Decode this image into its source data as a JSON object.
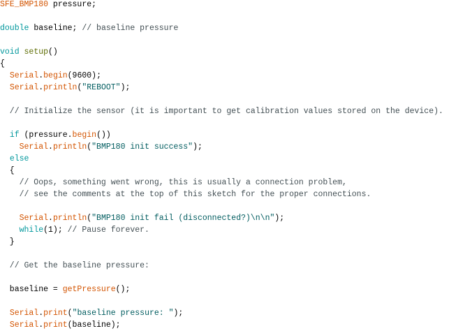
{
  "editor": {
    "colors": {
      "keyword": "#00979c",
      "function": "#d35400",
      "structure": "#5e6d03",
      "comment": "#434f54",
      "string": "#005c5f",
      "text": "#000000"
    },
    "lines": [
      [
        {
          "t": "SFE_BMP180",
          "c": "fn"
        },
        {
          "t": " pressure;",
          "c": "tx"
        }
      ],
      [],
      [
        {
          "t": "double",
          "c": "kw"
        },
        {
          "t": " baseline; ",
          "c": "tx"
        },
        {
          "t": "// baseline pressure",
          "c": "cm"
        }
      ],
      [],
      [
        {
          "t": "void",
          "c": "kw"
        },
        {
          "t": " ",
          "c": "tx"
        },
        {
          "t": "setup",
          "c": "setup"
        },
        {
          "t": "()",
          "c": "tx"
        }
      ],
      [
        {
          "t": "{",
          "c": "tx"
        }
      ],
      [
        {
          "t": "  ",
          "c": "tx"
        },
        {
          "t": "Serial",
          "c": "fn"
        },
        {
          "t": ".",
          "c": "tx"
        },
        {
          "t": "begin",
          "c": "fn"
        },
        {
          "t": "(9600);",
          "c": "tx"
        }
      ],
      [
        {
          "t": "  ",
          "c": "tx"
        },
        {
          "t": "Serial",
          "c": "fn"
        },
        {
          "t": ".",
          "c": "tx"
        },
        {
          "t": "println",
          "c": "fn"
        },
        {
          "t": "(",
          "c": "tx"
        },
        {
          "t": "\"REBOOT\"",
          "c": "str"
        },
        {
          "t": ");",
          "c": "tx"
        }
      ],
      [],
      [
        {
          "t": "  // Initialize the sensor (it is important to get calibration values stored on the device).",
          "c": "cm"
        }
      ],
      [],
      [
        {
          "t": "  ",
          "c": "tx"
        },
        {
          "t": "if",
          "c": "kw"
        },
        {
          "t": " (pressure.",
          "c": "tx"
        },
        {
          "t": "begin",
          "c": "fn"
        },
        {
          "t": "())",
          "c": "tx"
        }
      ],
      [
        {
          "t": "    ",
          "c": "tx"
        },
        {
          "t": "Serial",
          "c": "fn"
        },
        {
          "t": ".",
          "c": "tx"
        },
        {
          "t": "println",
          "c": "fn"
        },
        {
          "t": "(",
          "c": "tx"
        },
        {
          "t": "\"BMP180 init success\"",
          "c": "str"
        },
        {
          "t": ");",
          "c": "tx"
        }
      ],
      [
        {
          "t": "  ",
          "c": "tx"
        },
        {
          "t": "else",
          "c": "kw"
        }
      ],
      [
        {
          "t": "  {",
          "c": "tx"
        }
      ],
      [
        {
          "t": "    // Oops, something went wrong, this is usually a connection problem,",
          "c": "cm"
        }
      ],
      [
        {
          "t": "    // see the comments at the top of this sketch for the proper connections.",
          "c": "cm"
        }
      ],
      [],
      [
        {
          "t": "    ",
          "c": "tx"
        },
        {
          "t": "Serial",
          "c": "fn"
        },
        {
          "t": ".",
          "c": "tx"
        },
        {
          "t": "println",
          "c": "fn"
        },
        {
          "t": "(",
          "c": "tx"
        },
        {
          "t": "\"BMP180 init fail (disconnected?)\\n\\n\"",
          "c": "str"
        },
        {
          "t": ");",
          "c": "tx"
        }
      ],
      [
        {
          "t": "    ",
          "c": "tx"
        },
        {
          "t": "while",
          "c": "kw"
        },
        {
          "t": "(1); ",
          "c": "tx"
        },
        {
          "t": "// Pause forever.",
          "c": "cm"
        }
      ],
      [
        {
          "t": "  }",
          "c": "tx"
        }
      ],
      [],
      [
        {
          "t": "  // Get the baseline pressure:",
          "c": "cm"
        }
      ],
      [],
      [
        {
          "t": "  baseline = ",
          "c": "tx"
        },
        {
          "t": "getPressure",
          "c": "fn"
        },
        {
          "t": "();",
          "c": "tx"
        }
      ],
      [],
      [
        {
          "t": "  ",
          "c": "tx"
        },
        {
          "t": "Serial",
          "c": "fn"
        },
        {
          "t": ".",
          "c": "tx"
        },
        {
          "t": "print",
          "c": "fn"
        },
        {
          "t": "(",
          "c": "tx"
        },
        {
          "t": "\"baseline pressure: \"",
          "c": "str"
        },
        {
          "t": ");",
          "c": "tx"
        }
      ],
      [
        {
          "t": "  ",
          "c": "tx"
        },
        {
          "t": "Serial",
          "c": "fn"
        },
        {
          "t": ".",
          "c": "tx"
        },
        {
          "t": "print",
          "c": "fn"
        },
        {
          "t": "(baseline);",
          "c": "tx"
        }
      ]
    ]
  }
}
